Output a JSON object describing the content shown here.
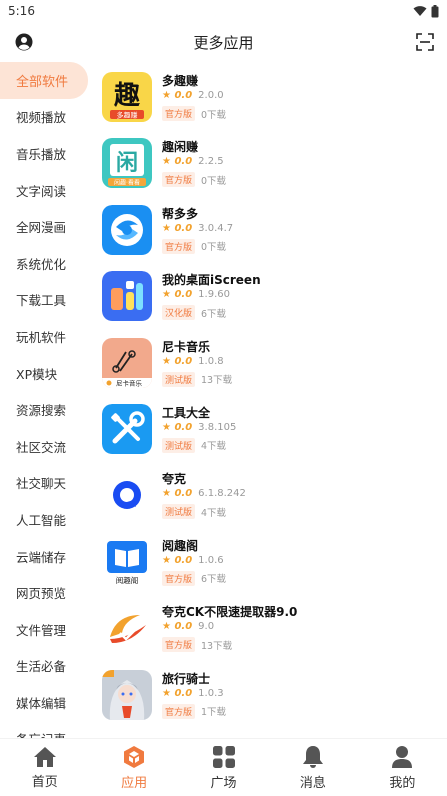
{
  "status": {
    "time": "5:16"
  },
  "header": {
    "title": "更多应用"
  },
  "sidebar": {
    "items": [
      {
        "label": "全部软件"
      },
      {
        "label": "视频播放"
      },
      {
        "label": "音乐播放"
      },
      {
        "label": "文字阅读"
      },
      {
        "label": "全网漫画"
      },
      {
        "label": "系统优化"
      },
      {
        "label": "下载工具"
      },
      {
        "label": "玩机软件"
      },
      {
        "label": "XP模块"
      },
      {
        "label": "资源搜索"
      },
      {
        "label": "社区交流"
      },
      {
        "label": "社交聊天"
      },
      {
        "label": "人工智能"
      },
      {
        "label": "云端储存"
      },
      {
        "label": "网页预览"
      },
      {
        "label": "文件管理"
      },
      {
        "label": "生活必备"
      },
      {
        "label": "媒体编辑"
      },
      {
        "label": "备忘记事"
      }
    ]
  },
  "apps": [
    {
      "name": "多趣赚",
      "rating": "★ 0.0",
      "version": "2.0.0",
      "badge": "官方版",
      "downloads": "0下载",
      "icon_text": "趣",
      "icon_sub": "多趣赚",
      "icon_bg": "#f9d648"
    },
    {
      "name": "趣闲赚",
      "rating": "★ 0.0",
      "version": "2.2.5",
      "badge": "官方版",
      "downloads": "0下载",
      "icon_text": "闲",
      "icon_sub": "闲趣·看看",
      "icon_bg": "#3ec7c1"
    },
    {
      "name": "帮多多",
      "rating": "★ 0.0",
      "version": "3.0.4.7",
      "badge": "官方版",
      "downloads": "0下载",
      "icon_bg": "#1a8ff2"
    },
    {
      "name": "我的桌面iScreen",
      "rating": "★ 0.0",
      "version": "1.9.60",
      "badge": "汉化版",
      "downloads": "6下载",
      "icon_bg": "#3a6df2"
    },
    {
      "name": "尼卡音乐",
      "rating": "★ 0.0",
      "version": "1.0.8",
      "badge": "测试版",
      "downloads": "13下载",
      "icon_sub": "尼卡音乐",
      "icon_bg": "#f2a98c"
    },
    {
      "name": "工具大全",
      "rating": "★ 0.0",
      "version": "3.8.105",
      "badge": "测试版",
      "downloads": "4下载",
      "icon_bg": "#1a9af2"
    },
    {
      "name": "夸克",
      "rating": "★ 0.0",
      "version": "6.1.8.242",
      "badge": "测试版",
      "downloads": "4下载",
      "icon_bg": "#ffffff"
    },
    {
      "name": "阅趣阁",
      "rating": "★ 0.0",
      "version": "1.0.6",
      "badge": "官方版",
      "downloads": "6下载",
      "icon_sub": "阅趣阁",
      "icon_bg": "#1a7af2"
    },
    {
      "name": "夸克CK不限速提取器9.0",
      "rating": "★ 0.0",
      "version": "9.0",
      "badge": "官方版",
      "downloads": "13下载",
      "icon_bg": "#ffffff"
    },
    {
      "name": "旅行骑士",
      "rating": "★ 0.0",
      "version": "1.0.3",
      "badge": "官方版",
      "downloads": "1下载",
      "icon_bg": "#c8cfd8"
    }
  ],
  "tabbar": {
    "items": [
      {
        "label": "首页",
        "icon": "home-icon"
      },
      {
        "label": "应用",
        "icon": "apps-box-icon"
      },
      {
        "label": "广场",
        "icon": "grid-icon"
      },
      {
        "label": "消息",
        "icon": "bell-icon"
      },
      {
        "label": "我的",
        "icon": "person-icon"
      }
    ],
    "active": 1
  },
  "colors": {
    "accent": "#f07a3f",
    "active_bg": "#fde4d6",
    "star": "#f2a22e"
  }
}
